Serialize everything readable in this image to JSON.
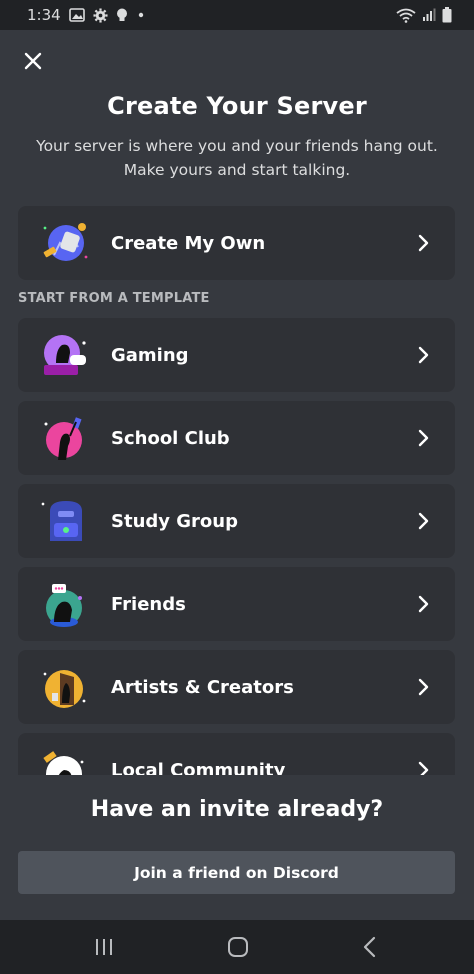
{
  "status_bar": {
    "time": "1:34"
  },
  "header": {
    "title": "Create Your Server",
    "subtitle": "Your server is where you and your friends hang out. Make yours and start talking."
  },
  "create_own": {
    "label": "Create My Own"
  },
  "templates": {
    "section_title": "START FROM A TEMPLATE",
    "items": [
      {
        "label": "Gaming"
      },
      {
        "label": "School Club"
      },
      {
        "label": "Study Group"
      },
      {
        "label": "Friends"
      },
      {
        "label": "Artists & Creators"
      },
      {
        "label": "Local Community"
      }
    ]
  },
  "invite": {
    "title": "Have an invite already?",
    "button_label": "Join a friend on Discord"
  },
  "colors": {
    "background": "#36393f",
    "card": "#2f3136",
    "button": "#4f545c",
    "bar": "#202225"
  }
}
